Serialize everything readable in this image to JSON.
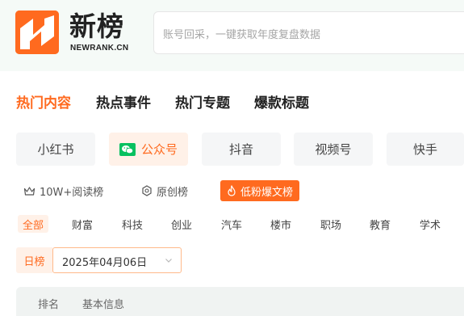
{
  "header": {
    "brand_cn": "新榜",
    "brand_en": "NEWRANK.CN",
    "search_placeholder": "账号回采，一键获取年度复盘数据"
  },
  "main_tabs": [
    {
      "label": "热门内容",
      "active": true
    },
    {
      "label": "热点事件",
      "active": false
    },
    {
      "label": "热门专题",
      "active": false
    },
    {
      "label": "爆款标题",
      "active": false
    }
  ],
  "platforms": [
    {
      "label": "小红书",
      "active": false
    },
    {
      "label": "公众号",
      "active": true,
      "icon": "wechat-icon"
    },
    {
      "label": "抖音",
      "active": false
    },
    {
      "label": "视频号",
      "active": false
    },
    {
      "label": "快手",
      "active": false
    }
  ],
  "sub_tabs": [
    {
      "label": "10W+阅读榜",
      "icon": "crown-icon",
      "active": false
    },
    {
      "label": "原创榜",
      "icon": "original-badge-icon",
      "active": false
    },
    {
      "label": "低粉爆文榜",
      "icon": "flame-icon",
      "active": true
    }
  ],
  "categories": [
    {
      "label": "全部",
      "active": true
    },
    {
      "label": "财富",
      "active": false
    },
    {
      "label": "科技",
      "active": false
    },
    {
      "label": "创业",
      "active": false
    },
    {
      "label": "汽车",
      "active": false
    },
    {
      "label": "楼市",
      "active": false
    },
    {
      "label": "职场",
      "active": false
    },
    {
      "label": "教育",
      "active": false
    },
    {
      "label": "学术",
      "active": false
    }
  ],
  "date_filter": {
    "period_label": "日榜",
    "date_value": "2025年04月06日"
  },
  "table": {
    "columns": [
      "排名",
      "基本信息"
    ]
  },
  "colors": {
    "accent": "#ff6a1f",
    "accent_light": "#fff1e8",
    "wechat_green": "#07c160"
  }
}
